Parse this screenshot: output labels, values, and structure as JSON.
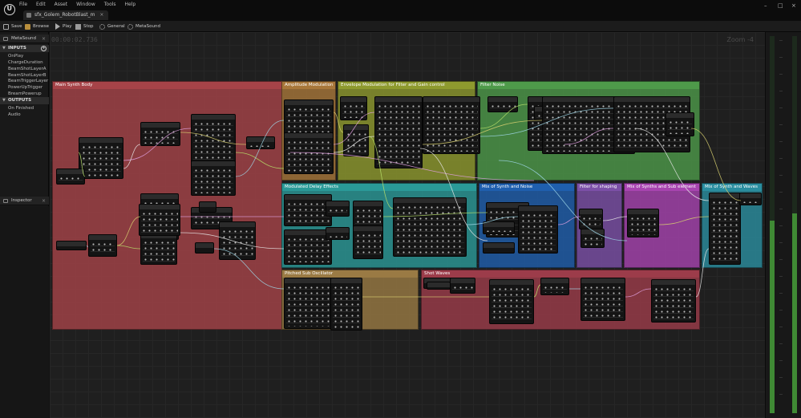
{
  "app": {
    "tab_title": "sfx_Golem_RobotBlast_m",
    "tab_close": "×",
    "menu": [
      "File",
      "Edit",
      "Asset",
      "Window",
      "Tools",
      "Help"
    ],
    "window_controls": [
      "–",
      "□",
      "×"
    ]
  },
  "toolbar": {
    "save": "Save",
    "browse": "Browse",
    "play": "Play",
    "stop": "Stop",
    "general": "General",
    "metasound": "MetaSound"
  },
  "left_panel": {
    "tab_label": "MetaSound",
    "inputs_header": "INPUTS",
    "inputs": [
      "OnPlay",
      "ChargeDuration",
      "BeamShotLayerA",
      "BeamShotLayerB",
      "BeamTriggerLayer",
      "PowerUpTrigger",
      "BreamPowerup"
    ],
    "outputs_header": "OUTPUTS",
    "outputs": [
      "On Finished",
      "Audio"
    ],
    "inspector_label": "Inspector"
  },
  "graph": {
    "time": "00:00:02.736",
    "zoom": "Zoom -4",
    "comments": [
      "Main Synth Body",
      "Amplitude Modulation",
      "Envelope Modulation for Filter and Gain control",
      "Filter Noise",
      "Modulated Delay Effects",
      "Mix of Synth and Noise",
      "Filter for shaping",
      "Mix of Synths and Sub element",
      "Mix of Synth and Waves",
      "Pitched Sub Oscillator",
      "Shot Waves"
    ]
  },
  "colors": {
    "main_synth": "#a64348",
    "amp_mod": "#a8773a",
    "env_mod": "#8e9a2e",
    "filter_noise": "#4e9a4a",
    "delay": "#2a9a98",
    "mix_noise": "#1f5fae",
    "filter_shape": "#7c50a8",
    "mix_sub": "#a844b0",
    "mix_waves": "#2a8ea0",
    "sub_osc": "#9a7a44",
    "shot_waves": "#9c3c4a",
    "meter_green": "#3f8a34"
  },
  "meters": {
    "left_level": 0.51,
    "right_level": 0.53
  }
}
